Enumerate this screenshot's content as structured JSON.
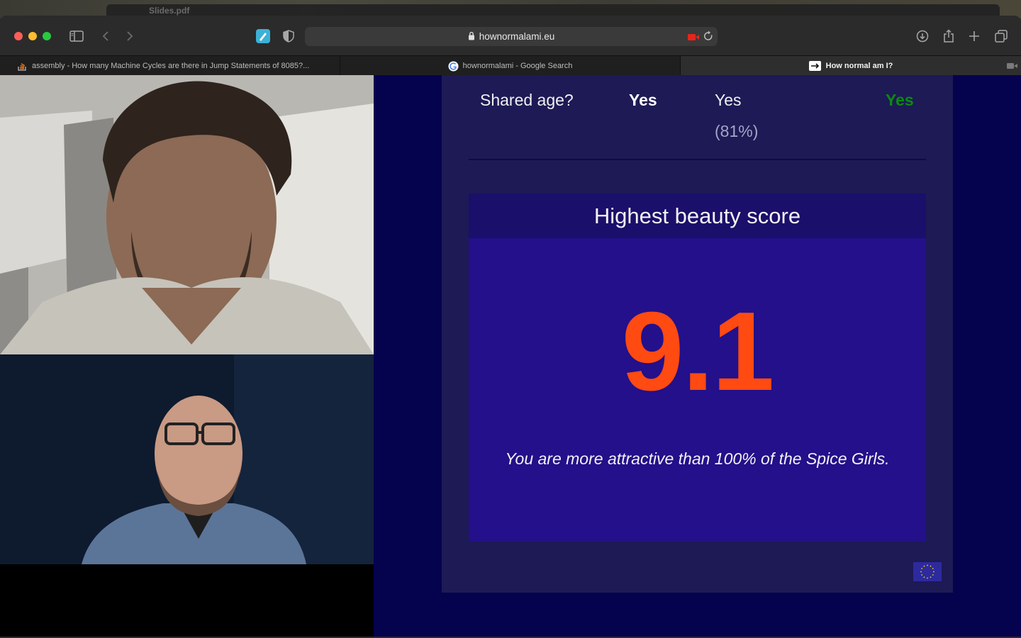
{
  "background_window": {
    "title": "Slides.pdf"
  },
  "browser": {
    "address": "hownormalami.eu",
    "tabs": [
      {
        "label": "assembly - How many Machine Cycles are there in Jump Statements of 8085?...",
        "icon": "stackoverflow-icon",
        "active": false
      },
      {
        "label": "hownormalami - Google Search",
        "icon": "google-icon",
        "active": false
      },
      {
        "label": "How normal am I?",
        "icon": "arrow-icon",
        "active": true
      }
    ]
  },
  "video_call": {
    "participants": [
      {
        "position": "top"
      },
      {
        "position": "bottom"
      }
    ]
  },
  "page": {
    "shared_age_row": {
      "label": "Shared age?",
      "answer_you": "Yes",
      "answer_others": "Yes",
      "answer_others_pct": "(81%)",
      "answer_result": "Yes"
    },
    "score_card": {
      "title": "Highest beauty score",
      "score": "9.1",
      "message": "You are more attractive than 100% of the Spice Girls."
    }
  },
  "colors": {
    "page_background": "#05034e",
    "panel": "#1d1a55",
    "score_header": "#1a0f6a",
    "score_body": "#23108a",
    "score_number": "#ff4a12",
    "result_green": "#0c8a12"
  }
}
